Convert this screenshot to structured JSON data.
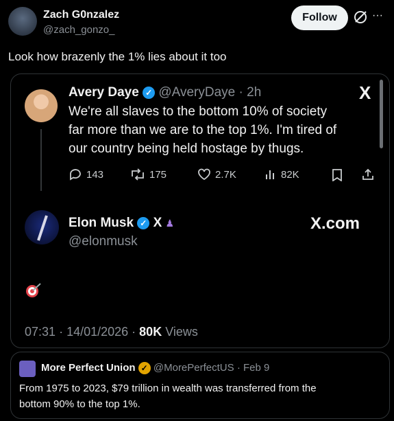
{
  "post": {
    "author_name": "Zach G0nzalez",
    "author_handle": "@zach_gonzo_",
    "follow_label": "Follow",
    "text": "Look how brazenly the 1% lies about it too",
    "more_label": "···"
  },
  "embed": {
    "avery": {
      "name": "Avery Daye",
      "handle": "@AveryDaye",
      "time": "· 2h",
      "text_lines": [
        "We're all slaves to the bottom 10% of society",
        "far more than we are to the top 1%. I'm tired of",
        "our country being held hostage by thugs."
      ],
      "x_logo": "X",
      "stats": {
        "replies": "143",
        "reposts": "175",
        "likes": "2.7K",
        "views": "82K"
      }
    },
    "elon": {
      "name": "Elon Musk",
      "handle": "@elonmusk",
      "x_mark": "X",
      "x_com": "X.com"
    },
    "meta": {
      "time": "07:31",
      "date": "14/01/2026",
      "views_count": "80K",
      "views_label": "Views"
    }
  },
  "quote": {
    "name": "More Perfect Union",
    "handle": "@MorePerfectUS",
    "date": "· Feb 9",
    "line1": "From 1975 to 2023, $79 trillion in wealth was transferred from the",
    "line2": "bottom 90% to the top 1%."
  },
  "colors": {
    "background": "#000000",
    "accent": "#1d9bf0",
    "gold": "#e3a400"
  }
}
